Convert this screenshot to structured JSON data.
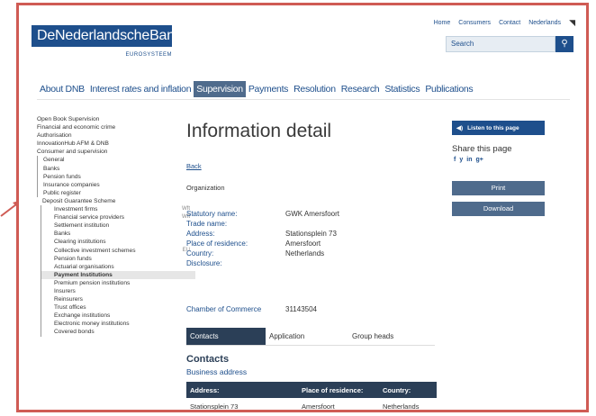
{
  "header": {
    "logo_text": "DeNederlandscheBank",
    "logo_sub": "EUROSYSTEEM",
    "toplinks": [
      "Home",
      "Consumers",
      "Contact",
      "Nederlands"
    ],
    "search_placeholder": "Search"
  },
  "nav": {
    "items": [
      "About DNB",
      "Interest rates and inflation",
      "Supervision",
      "Payments",
      "Resolution",
      "Research",
      "Statistics",
      "Publications"
    ],
    "active": "Supervision"
  },
  "sidebar": {
    "top": [
      "Open Book Supervision",
      "Financial and economic crime",
      "Authorisation",
      "InnovationHub AFM & DNB",
      "Consumer and supervision"
    ],
    "level1": [
      "General",
      "Banks",
      "Pension funds",
      "Insurance companies",
      "Public register"
    ],
    "dgs": "Deposit Guarantee Scheme",
    "level2": [
      "Investment firms",
      "Financial service providers",
      "Settlement institution",
      "Banks",
      "Clearing institutions",
      "Collective investment schemes",
      "Pension funds",
      "Actuarial organisations",
      "Payment Institutions",
      "Premium pension institutions",
      "Insurers",
      "Reinsurers",
      "Trust offices",
      "Exchange institutions",
      "Electronic money institutions",
      "Covered bonds"
    ],
    "tag_wft": "Wft",
    "tag_eu": "EU"
  },
  "main": {
    "title": "Information detail",
    "back": "Back",
    "organization": "Organization",
    "details": [
      {
        "label": "Statutory name:",
        "value": "GWK Amersfoort"
      },
      {
        "label": "Trade name:",
        "value": ""
      },
      {
        "label": "Address:",
        "value": "Stationsplein 73"
      },
      {
        "label": "Place of residence:",
        "value": "Amersfoort"
      },
      {
        "label": "Country:",
        "value": "Netherlands"
      },
      {
        "label": "Disclosure:",
        "value": ""
      }
    ],
    "coc_label": "Chamber of Commerce",
    "coc_value": "31143504",
    "tabs": [
      "Contacts",
      "Application",
      "Group heads"
    ],
    "contacts_heading": "Contacts",
    "business_address": "Business address",
    "table": {
      "headers": [
        "Address:",
        "Place of residence:",
        "Country:"
      ],
      "rows": [
        [
          "Stationsplein 73",
          "Amersfoort",
          "Netherlands"
        ]
      ]
    }
  },
  "right": {
    "listen": "Listen to this page",
    "share": "Share this page",
    "share_icons": [
      "f",
      "y",
      "in",
      "g+"
    ],
    "print": "Print",
    "download": "Download"
  },
  "colors": {
    "brand": "#1e4f8c",
    "nav_active": "#4f6b8c",
    "tab_active": "#2b3f57",
    "frame": "#cf5b54"
  }
}
